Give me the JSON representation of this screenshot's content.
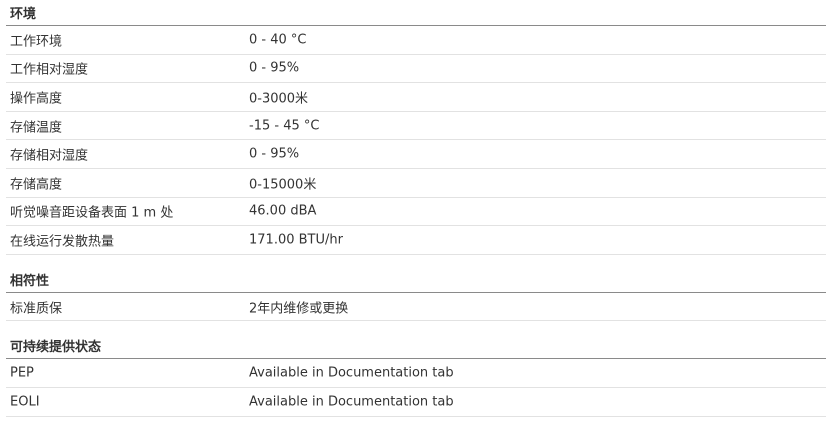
{
  "sections": [
    {
      "title": "环境",
      "rows": [
        {
          "label": "工作环境",
          "value": "0 - 40 °C"
        },
        {
          "label": "工作相对湿度",
          "value": "0 - 95%"
        },
        {
          "label": "操作高度",
          "value": "0-3000米"
        },
        {
          "label": "存储温度",
          "value": "-15 - 45 °C"
        },
        {
          "label": "存储相对湿度",
          "value": "0 - 95%"
        },
        {
          "label": "存储高度",
          "value": "0-15000米"
        },
        {
          "label": "听觉噪音距设备表面 1 m 处",
          "value": "46.00 dBA"
        },
        {
          "label": "在线运行发散热量",
          "value": "171.00 BTU/hr"
        }
      ]
    },
    {
      "title": "相符性",
      "rows": [
        {
          "label": "标准质保",
          "value": "2年内维修或更换"
        }
      ]
    },
    {
      "title": "可持续提供状态",
      "rows": [
        {
          "label": "PEP",
          "value": "Available in Documentation tab"
        },
        {
          "label": "EOLI",
          "value": "Available in Documentation tab"
        }
      ]
    }
  ]
}
